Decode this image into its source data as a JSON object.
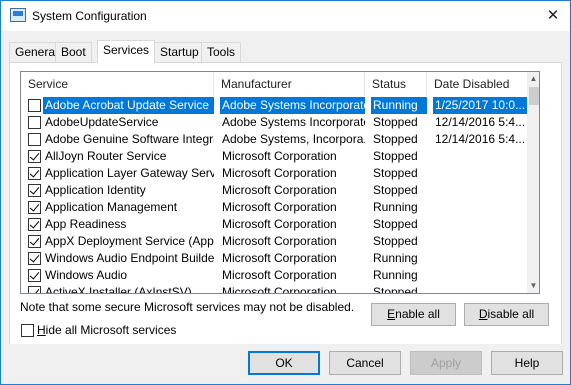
{
  "window": {
    "title": "System Configuration",
    "close_glyph": "✕"
  },
  "tabs": [
    {
      "label": "General"
    },
    {
      "label": "Boot"
    },
    {
      "label": "Services",
      "active": true
    },
    {
      "label": "Startup"
    },
    {
      "label": "Tools"
    }
  ],
  "services_list": {
    "columns": [
      "Service",
      "Manufacturer",
      "Status",
      "Date Disabled"
    ],
    "rows": [
      {
        "checked": false,
        "selected": true,
        "service": "Adobe Acrobat Update Service",
        "manufacturer": "Adobe Systems Incorporated",
        "status": "Running",
        "date_disabled": "1/25/2017 10:0..."
      },
      {
        "checked": false,
        "service": "AdobeUpdateService",
        "manufacturer": "Adobe Systems Incorporated",
        "status": "Stopped",
        "date_disabled": "12/14/2016 5:4..."
      },
      {
        "checked": false,
        "service": "Adobe Genuine Software Integri...",
        "manufacturer": "Adobe Systems, Incorpora...",
        "status": "Stopped",
        "date_disabled": "12/14/2016 5:4..."
      },
      {
        "checked": true,
        "service": "AllJoyn Router Service",
        "manufacturer": "Microsoft Corporation",
        "status": "Stopped",
        "date_disabled": ""
      },
      {
        "checked": true,
        "service": "Application Layer Gateway Service",
        "manufacturer": "Microsoft Corporation",
        "status": "Stopped",
        "date_disabled": ""
      },
      {
        "checked": true,
        "service": "Application Identity",
        "manufacturer": "Microsoft Corporation",
        "status": "Stopped",
        "date_disabled": ""
      },
      {
        "checked": true,
        "service": "Application Management",
        "manufacturer": "Microsoft Corporation",
        "status": "Running",
        "date_disabled": ""
      },
      {
        "checked": true,
        "service": "App Readiness",
        "manufacturer": "Microsoft Corporation",
        "status": "Stopped",
        "date_disabled": ""
      },
      {
        "checked": true,
        "service": "AppX Deployment Service (AppX...",
        "manufacturer": "Microsoft Corporation",
        "status": "Stopped",
        "date_disabled": ""
      },
      {
        "checked": true,
        "service": "Windows Audio Endpoint Builder",
        "manufacturer": "Microsoft Corporation",
        "status": "Running",
        "date_disabled": ""
      },
      {
        "checked": true,
        "service": "Windows Audio",
        "manufacturer": "Microsoft Corporation",
        "status": "Running",
        "date_disabled": ""
      },
      {
        "checked": true,
        "service": "ActiveX Installer (AxInstSV)",
        "manufacturer": "Microsoft Corporation",
        "status": "Stopped",
        "date_disabled": ""
      }
    ]
  },
  "note": "Note that some secure Microsoft services may not be disabled.",
  "enable_all": {
    "label_u": "E",
    "label_rest": "nable all"
  },
  "disable_all": {
    "label_u": "D",
    "label_rest": "isable all"
  },
  "hide_ms": {
    "label_u": "H",
    "label_rest": "ide all Microsoft services",
    "checked": false
  },
  "footer": {
    "ok": "OK",
    "cancel": "Cancel",
    "apply": "Apply",
    "help": "Help"
  }
}
